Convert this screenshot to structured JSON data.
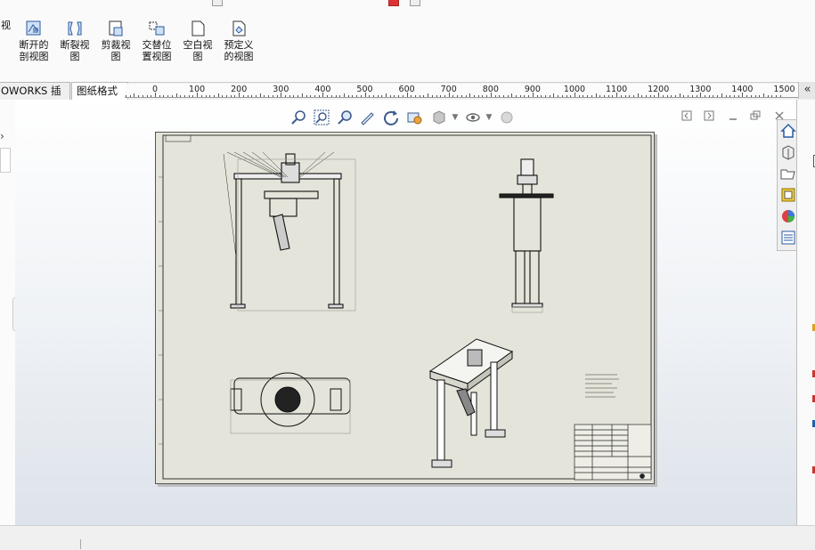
{
  "ribbon": {
    "buttons": [
      {
        "label": "视",
        "icon": "view-icon"
      },
      {
        "label": "断开的\n剖视图",
        "icon": "broken-out-section-icon"
      },
      {
        "label": "断裂视\n图",
        "icon": "break-view-icon"
      },
      {
        "label": "剪裁视\n图",
        "icon": "crop-view-icon"
      },
      {
        "label": "交替位\n置视图",
        "icon": "alternate-position-view-icon"
      },
      {
        "label": "空白视\n图",
        "icon": "empty-view-icon"
      },
      {
        "label": "预定义\n的视图",
        "icon": "predefined-view-icon"
      }
    ]
  },
  "tabs": [
    {
      "label": "OWORKS 插件"
    },
    {
      "label": "图纸格式"
    }
  ],
  "ruler": {
    "labels": [
      "0",
      "100",
      "200",
      "300",
      "400",
      "500",
      "600",
      "700",
      "800",
      "900",
      "1000",
      "1100",
      "1200",
      "1300",
      "1400",
      "1500"
    ]
  },
  "collapse_glyph": "«",
  "hud_icons": [
    "zoom-to-fit-icon",
    "zoom-to-area-icon",
    "zoom-in-out-icon",
    "sketch-icon",
    "rotate-icon",
    "section-view-icon",
    "display-style-icon",
    "hide-show-icon",
    "appearance-icon"
  ],
  "task_pane_icons": [
    "home-icon",
    "view-palette-icon",
    "open-folder-icon",
    "design-library-icon",
    "appearances-icon",
    "custom-properties-icon"
  ],
  "colors": {
    "accent": "#3d5a8a",
    "sheet": "#e4e4da"
  }
}
